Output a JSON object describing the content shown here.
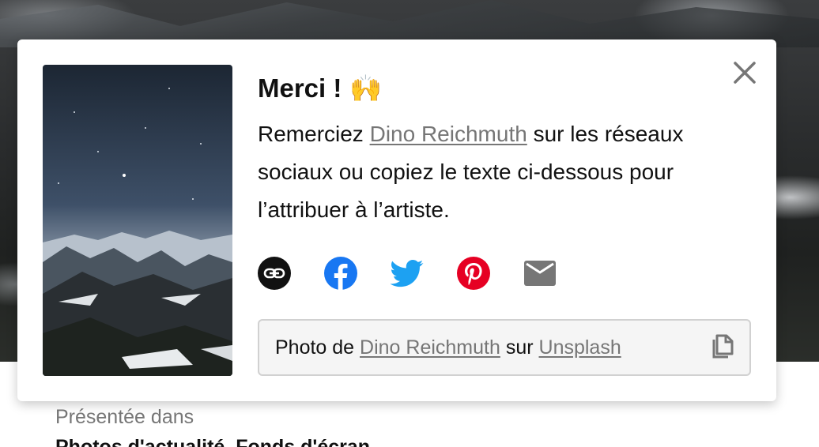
{
  "modal": {
    "title": "Merci !",
    "title_emoji": "🙌",
    "desc_before": "Remerciez ",
    "artist_name": "Dino Reichmuth",
    "desc_after": " sur les réseaux sociaux ou copiez le texte ci-dessous pour l’attribuer à l’artiste.",
    "share_icons": [
      "link-icon",
      "facebook-icon",
      "twitter-icon",
      "pinterest-icon",
      "email-icon"
    ],
    "attribution": {
      "prefix": "Photo de ",
      "artist": "Dino Reichmuth",
      "middle": " sur ",
      "site": "Unsplash"
    }
  },
  "below": {
    "featured_label": "Présentée dans",
    "featured_value": "Photos d'actualité, Fonds d'écran"
  },
  "colors": {
    "facebook": "#1877F2",
    "twitter": "#1DA1F2",
    "pinterest": "#E60023",
    "icon_dark": "#111111",
    "link_grey": "#767676"
  }
}
